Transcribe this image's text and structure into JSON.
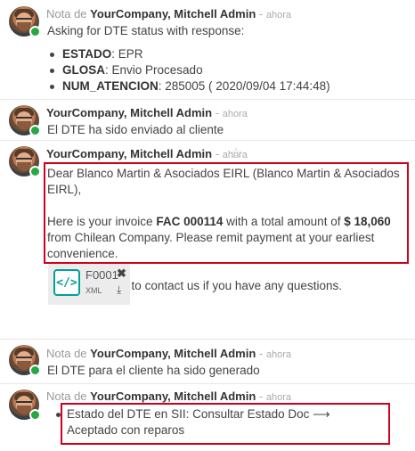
{
  "messages": [
    {
      "prefix": "Nota de",
      "author": "YourCompany, Mitchell Admin",
      "separator": "-",
      "time": "ahora",
      "intro": "Asking for DTE status with response:",
      "items": [
        {
          "key": "ESTADO",
          "value": ": EPR"
        },
        {
          "key": "GLOSA",
          "value": ": Envio Procesado"
        },
        {
          "key": "NUM_ATENCION",
          "value": ": 285005 ( 2020/09/04 17:44:48)"
        }
      ]
    },
    {
      "author": "YourCompany, Mitchell Admin",
      "separator": "-",
      "time": "ahora",
      "text": "El DTE ha sido enviado al cliente"
    },
    {
      "author": "YourCompany, Mitchell Admin",
      "separator": "-",
      "time": "ahora",
      "star_icon": "star-outline-icon",
      "greeting": "Dear Blanco Martin & Asociados EIRL (Blanco Martin & Asociados EIRL),",
      "invoice_pre": "Here is your invoice ",
      "invoice_number": "FAC 000114",
      "invoice_mid": " with a total amount of ",
      "invoice_amount": "$ 18,060",
      "invoice_post": " from Chilean Company. Please remit payment at your earliest convenience.",
      "closing": "Do not hesitate to contact us if you have any questions.",
      "attachment": {
        "name": "F0001",
        "type": "XML",
        "icon": "code-file-icon",
        "remove_icon": "close-icon",
        "download_icon": "download-icon"
      }
    },
    {
      "prefix": "Nota de",
      "author": "YourCompany, Mitchell Admin",
      "separator": "-",
      "time": "ahora",
      "text": "El DTE para el cliente ha sido generado"
    },
    {
      "prefix": "Nota de",
      "author": "YourCompany, Mitchell Admin",
      "separator": "-",
      "time": "ahora",
      "status_text": "Estado del DTE en SII: Consultar Estado Doc ⟶ Aceptado con reparos"
    }
  ],
  "colors": {
    "highlight": "#d0021b",
    "online": "#28a745",
    "accent": "#00a09d"
  }
}
